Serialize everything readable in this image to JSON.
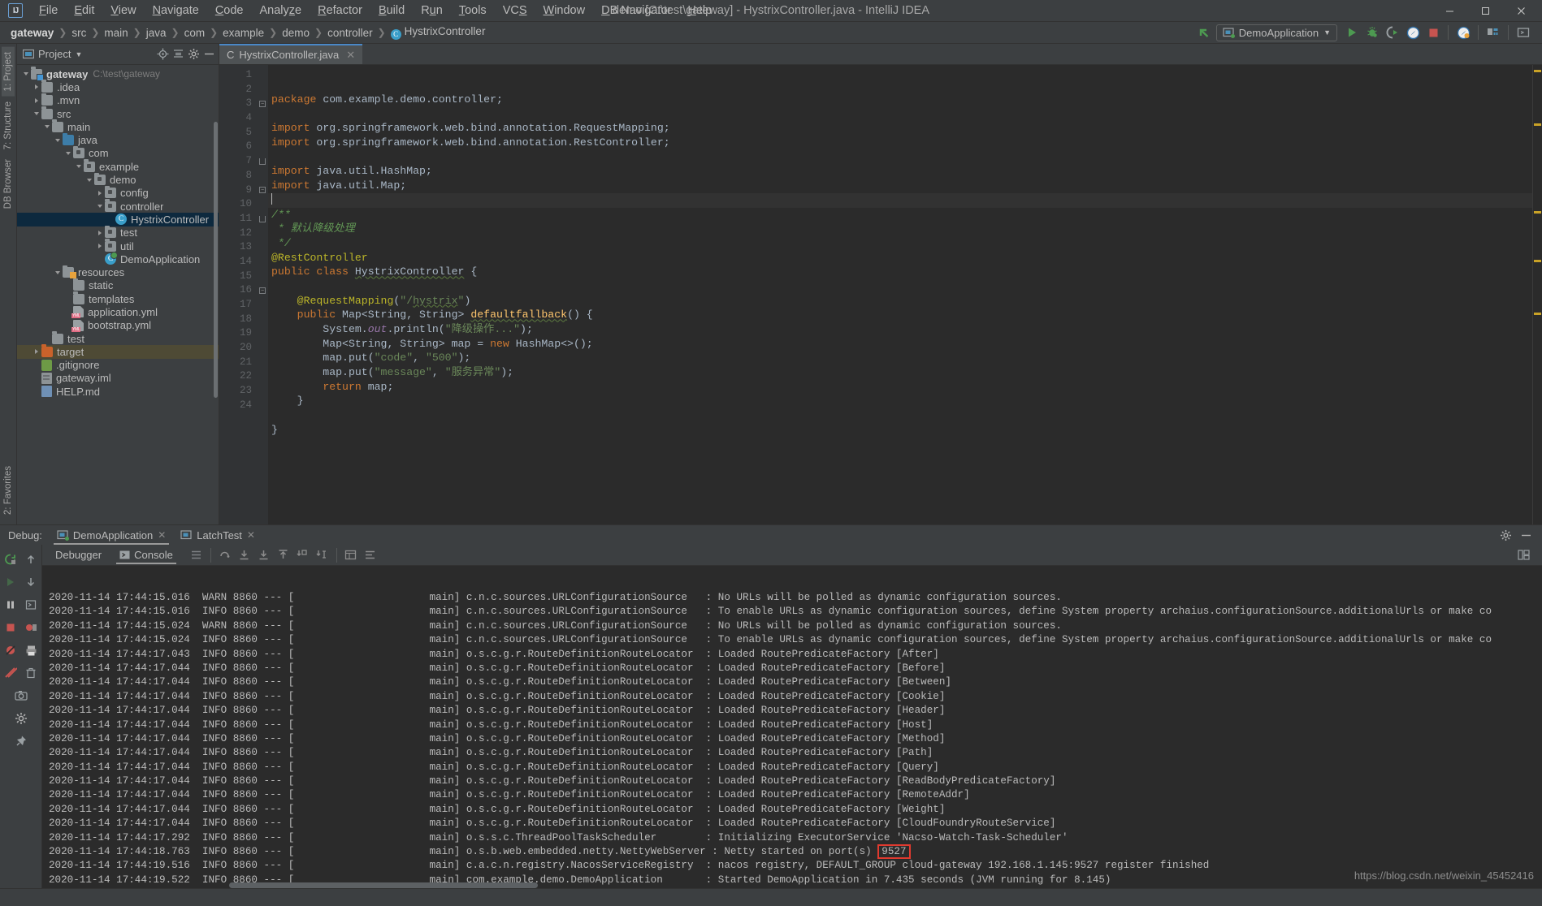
{
  "window": {
    "title": "demo [C:\\test\\gateway] - HystrixController.java - IntelliJ IDEA",
    "logo": "intellij-idea-logo",
    "minimize": "—",
    "maximize": "▢",
    "close": "✕"
  },
  "menu": [
    {
      "label": "File",
      "mnemonic": "F"
    },
    {
      "label": "Edit",
      "mnemonic": "E"
    },
    {
      "label": "View",
      "mnemonic": "V"
    },
    {
      "label": "Navigate",
      "mnemonic": "N"
    },
    {
      "label": "Code",
      "mnemonic": "C"
    },
    {
      "label": "Analyze",
      "mnemonic": "z"
    },
    {
      "label": "Refactor",
      "mnemonic": "R"
    },
    {
      "label": "Build",
      "mnemonic": "B"
    },
    {
      "label": "Run",
      "mnemonic": "u"
    },
    {
      "label": "Tools",
      "mnemonic": "T"
    },
    {
      "label": "VCS",
      "mnemonic": "S"
    },
    {
      "label": "Window",
      "mnemonic": "W"
    },
    {
      "label": "DB Navigator",
      "mnemonic": "D"
    },
    {
      "label": "Help",
      "mnemonic": "H"
    }
  ],
  "breadcrumbs": [
    {
      "label": "gateway",
      "bold": true
    },
    {
      "label": "src",
      "bold": false
    },
    {
      "label": "main",
      "bold": false
    },
    {
      "label": "java",
      "bold": false
    },
    {
      "label": "com",
      "bold": false
    },
    {
      "label": "example",
      "bold": false
    },
    {
      "label": "demo",
      "bold": false
    },
    {
      "label": "controller",
      "bold": false
    },
    {
      "label": "HystrixController",
      "bold": false,
      "icon": "class-icon"
    }
  ],
  "toolbar": {
    "nav_up_icon": "navigate-up-icon",
    "run_config_name": "DemoApplication",
    "run_config_icon": "application-config-icon",
    "dropdown_icon": "chevron-down-icon",
    "buttons": [
      {
        "name": "run-button",
        "icon": "play-icon",
        "color": "#4d9a51"
      },
      {
        "name": "debug-button",
        "icon": "bug-icon",
        "color": "#4d9a51"
      },
      {
        "name": "run-with-coverage-button",
        "icon": "coverage-icon",
        "color": "#9a9a9a"
      },
      {
        "name": "profile-button",
        "icon": "profiler-icon",
        "color": "#4a88c7"
      },
      {
        "name": "stop-button",
        "icon": "stop-square-icon",
        "color": "#c75450"
      },
      {
        "name": "update-app-button",
        "icon": "update-icon",
        "color": "#4a88c7"
      },
      {
        "name": "project-structure-button",
        "icon": "project-structure-icon",
        "color": "#9a9a9a"
      },
      {
        "name": "terminal-button",
        "icon": "terminal-icon",
        "color": "#9a9a9a"
      }
    ]
  },
  "left_strip": {
    "tabs": [
      {
        "label": "1: Project",
        "icon": "project-icon",
        "active": true
      },
      {
        "label": "7: Structure",
        "icon": "structure-icon",
        "active": false
      },
      {
        "label": "DB Browser",
        "icon": "database-icon",
        "active": false
      }
    ],
    "bottom": [
      {
        "label": "2: Favorites",
        "icon": "favorites-icon"
      }
    ]
  },
  "project_panel": {
    "title": "Project",
    "dropdown_icon": "chevron-down-icon",
    "header_icons": [
      "locate-icon",
      "collapse-all-icon",
      "settings-gear-icon",
      "hide-icon"
    ],
    "tree": [
      {
        "depth": 0,
        "label": "gateway",
        "suffix": "C:\\test\\gateway",
        "icon": "module-folder",
        "expander": "open",
        "bold": true,
        "state": "normal"
      },
      {
        "depth": 1,
        "label": ".idea",
        "icon": "folder-gray",
        "expander": "closed",
        "state": "normal"
      },
      {
        "depth": 1,
        "label": ".mvn",
        "icon": "folder-gray",
        "expander": "closed",
        "state": "normal"
      },
      {
        "depth": 1,
        "label": "src",
        "icon": "folder-gray",
        "expander": "open",
        "state": "normal"
      },
      {
        "depth": 2,
        "label": "main",
        "icon": "folder-gray",
        "expander": "open",
        "state": "normal"
      },
      {
        "depth": 3,
        "label": "java",
        "icon": "folder-blue",
        "expander": "open",
        "state": "normal"
      },
      {
        "depth": 4,
        "label": "com",
        "icon": "package",
        "expander": "open",
        "state": "normal"
      },
      {
        "depth": 5,
        "label": "example",
        "icon": "package",
        "expander": "open",
        "state": "normal"
      },
      {
        "depth": 6,
        "label": "demo",
        "icon": "package",
        "expander": "open",
        "state": "normal"
      },
      {
        "depth": 7,
        "label": "config",
        "icon": "package",
        "expander": "closed",
        "state": "normal"
      },
      {
        "depth": 7,
        "label": "controller",
        "icon": "package",
        "expander": "open",
        "state": "normal"
      },
      {
        "depth": 8,
        "label": "HystrixController",
        "icon": "class",
        "expander": "none",
        "state": "selected"
      },
      {
        "depth": 7,
        "label": "test",
        "icon": "package",
        "expander": "closed",
        "state": "normal"
      },
      {
        "depth": 7,
        "label": "util",
        "icon": "package",
        "expander": "closed",
        "state": "normal"
      },
      {
        "depth": 7,
        "label": "DemoApplication",
        "icon": "class-run",
        "expander": "none",
        "state": "normal"
      },
      {
        "depth": 3,
        "label": "resources",
        "icon": "folder-resources",
        "expander": "open",
        "state": "normal"
      },
      {
        "depth": 4,
        "label": "static",
        "icon": "folder-gray",
        "expander": "none",
        "state": "normal"
      },
      {
        "depth": 4,
        "label": "templates",
        "icon": "folder-gray",
        "expander": "none",
        "state": "normal"
      },
      {
        "depth": 4,
        "label": "application.yml",
        "icon": "yml",
        "expander": "none",
        "state": "normal"
      },
      {
        "depth": 4,
        "label": "bootstrap.yml",
        "icon": "yml",
        "expander": "none",
        "state": "normal"
      },
      {
        "depth": 2,
        "label": "test",
        "icon": "folder-gray",
        "expander": "none",
        "state": "normal"
      },
      {
        "depth": 1,
        "label": "target",
        "icon": "folder-orange",
        "expander": "closed",
        "state": "selected-inactive"
      },
      {
        "depth": 1,
        "label": ".gitignore",
        "icon": "gitignore",
        "expander": "none",
        "state": "normal"
      },
      {
        "depth": 1,
        "label": "gateway.iml",
        "icon": "iml",
        "expander": "none",
        "state": "normal"
      },
      {
        "depth": 1,
        "label": "HELP.md",
        "icon": "markdown",
        "expander": "none",
        "state": "normal"
      }
    ]
  },
  "editor": {
    "tab": {
      "label": "HystrixController.java",
      "icon": "class-icon",
      "close": "✕"
    },
    "line_numbers": [
      1,
      2,
      3,
      4,
      5,
      6,
      7,
      8,
      9,
      10,
      11,
      12,
      13,
      14,
      15,
      16,
      17,
      18,
      19,
      20,
      21,
      22,
      23,
      24
    ],
    "current_line": 8,
    "lines": [
      {
        "n": 1,
        "html": "<span class='kw'>package</span> com.example.demo.controller;"
      },
      {
        "n": 2,
        "html": ""
      },
      {
        "n": 3,
        "html": "<span class='kw'>import</span> org.springframework.web.bind.annotation.<span class='cls-name'>RequestMapping</span>;"
      },
      {
        "n": 4,
        "html": "<span class='kw'>import</span> org.springframework.web.bind.annotation.<span class='cls-name'>RestController</span>;"
      },
      {
        "n": 5,
        "html": ""
      },
      {
        "n": 6,
        "html": "<span class='kw'>import</span> java.util.HashMap;"
      },
      {
        "n": 7,
        "html": "<span class='kw'>import</span> java.util.Map;"
      },
      {
        "n": 8,
        "html": "<span class='caret'></span>"
      },
      {
        "n": 9,
        "html": "<span class='cmt'>/**</span>"
      },
      {
        "n": 10,
        "html": "<span class='cmt'> * 默认降级处理</span>"
      },
      {
        "n": 11,
        "html": "<span class='cmt'> */</span>"
      },
      {
        "n": 12,
        "html": "<span class='ann'>@RestController</span>"
      },
      {
        "n": 13,
        "html": "<span class='kw'>public class</span> <span class='warnu'>HystrixController</span> {"
      },
      {
        "n": 14,
        "html": ""
      },
      {
        "n": 15,
        "html": "    <span class='ann'>@RequestMapping</span>(<span class='str'>\"/<span class='warnu'>hystrix</span>\"</span>)"
      },
      {
        "n": 16,
        "html": "    <span class='kw'>public</span> Map&lt;String, String&gt; <span class='warnu' style='color:#ffc66d'>defaultfallback</span>() {"
      },
      {
        "n": 17,
        "html": "        System.<span class='field-it'>out</span>.println(<span class='str'>\"降级操作...\"</span>);"
      },
      {
        "n": 18,
        "html": "        Map&lt;String, String&gt; map = <span class='kw'>new</span> HashMap&lt;&gt;();"
      },
      {
        "n": 19,
        "html": "        map.put(<span class='str'>\"code\"</span>, <span class='str'>\"500\"</span>);"
      },
      {
        "n": 20,
        "html": "        map.put(<span class='str'>\"message\"</span>, <span class='str'>\"服务异常\"</span>);"
      },
      {
        "n": 21,
        "html": "        <span class='kw'>return</span> map;"
      },
      {
        "n": 22,
        "html": "    }"
      },
      {
        "n": 23,
        "html": ""
      },
      {
        "n": 24,
        "html": "}"
      }
    ]
  },
  "debug": {
    "label": "Debug:",
    "tabs": [
      {
        "label": "DemoApplication",
        "icon": "app-config-icon",
        "active": true,
        "close": "✕"
      },
      {
        "label": "LatchTest",
        "icon": "app-config-icon",
        "active": false,
        "close": "✕"
      }
    ],
    "header_right_icons": [
      "settings-gear-icon",
      "hide-panel-icon"
    ],
    "subtabs": [
      {
        "label": "Debugger",
        "active": false
      },
      {
        "label": "Console",
        "active": true,
        "icon": "console-icon"
      }
    ],
    "toolbar_icons": [
      "soft-wrap-icon",
      "step-over-icon",
      "step-into-icon",
      "force-step-into-icon",
      "step-out-icon",
      "drop-frame-icon",
      "run-to-cursor-icon",
      "evaluate-expression-icon",
      "layout-icon"
    ],
    "left_icons": [
      "rerun-icon",
      "resume-icon",
      "step-up-icon",
      "pause-icon",
      "stop-icon",
      "view-breakpoints-icon",
      "mute-breakpoints-icon",
      "print-icon",
      "settings-icon",
      "camera-icon",
      "trash-icon",
      "gear-icon",
      "pin-icon"
    ],
    "right_icons": [
      "toggle-tabs-icon",
      "restore-layout-icon"
    ]
  },
  "console": {
    "port_highlight": "9527",
    "watermark": "https://blog.csdn.net/weixin_45452416",
    "lines": [
      {
        "ts": "2020-11-14 17:44:15.016",
        "level": "WARN",
        "pid": "8860",
        "thread": "main",
        "logger": "c.n.c.sources.URLConfigurationSource",
        "msg": "No URLs will be polled as dynamic configuration sources."
      },
      {
        "ts": "2020-11-14 17:44:15.016",
        "level": "INFO",
        "pid": "8860",
        "thread": "main",
        "logger": "c.n.c.sources.URLConfigurationSource",
        "msg": "To enable URLs as dynamic configuration sources, define System property archaius.configurationSource.additionalUrls or make co"
      },
      {
        "ts": "2020-11-14 17:44:15.024",
        "level": "WARN",
        "pid": "8860",
        "thread": "main",
        "logger": "c.n.c.sources.URLConfigurationSource",
        "msg": "No URLs will be polled as dynamic configuration sources."
      },
      {
        "ts": "2020-11-14 17:44:15.024",
        "level": "INFO",
        "pid": "8860",
        "thread": "main",
        "logger": "c.n.c.sources.URLConfigurationSource",
        "msg": "To enable URLs as dynamic configuration sources, define System property archaius.configurationSource.additionalUrls or make co"
      },
      {
        "ts": "2020-11-14 17:44:17.043",
        "level": "INFO",
        "pid": "8860",
        "thread": "main",
        "logger": "o.s.c.g.r.RouteDefinitionRouteLocator",
        "msg": "Loaded RoutePredicateFactory [After]"
      },
      {
        "ts": "2020-11-14 17:44:17.044",
        "level": "INFO",
        "pid": "8860",
        "thread": "main",
        "logger": "o.s.c.g.r.RouteDefinitionRouteLocator",
        "msg": "Loaded RoutePredicateFactory [Before]"
      },
      {
        "ts": "2020-11-14 17:44:17.044",
        "level": "INFO",
        "pid": "8860",
        "thread": "main",
        "logger": "o.s.c.g.r.RouteDefinitionRouteLocator",
        "msg": "Loaded RoutePredicateFactory [Between]"
      },
      {
        "ts": "2020-11-14 17:44:17.044",
        "level": "INFO",
        "pid": "8860",
        "thread": "main",
        "logger": "o.s.c.g.r.RouteDefinitionRouteLocator",
        "msg": "Loaded RoutePredicateFactory [Cookie]"
      },
      {
        "ts": "2020-11-14 17:44:17.044",
        "level": "INFO",
        "pid": "8860",
        "thread": "main",
        "logger": "o.s.c.g.r.RouteDefinitionRouteLocator",
        "msg": "Loaded RoutePredicateFactory [Header]"
      },
      {
        "ts": "2020-11-14 17:44:17.044",
        "level": "INFO",
        "pid": "8860",
        "thread": "main",
        "logger": "o.s.c.g.r.RouteDefinitionRouteLocator",
        "msg": "Loaded RoutePredicateFactory [Host]"
      },
      {
        "ts": "2020-11-14 17:44:17.044",
        "level": "INFO",
        "pid": "8860",
        "thread": "main",
        "logger": "o.s.c.g.r.RouteDefinitionRouteLocator",
        "msg": "Loaded RoutePredicateFactory [Method]"
      },
      {
        "ts": "2020-11-14 17:44:17.044",
        "level": "INFO",
        "pid": "8860",
        "thread": "main",
        "logger": "o.s.c.g.r.RouteDefinitionRouteLocator",
        "msg": "Loaded RoutePredicateFactory [Path]"
      },
      {
        "ts": "2020-11-14 17:44:17.044",
        "level": "INFO",
        "pid": "8860",
        "thread": "main",
        "logger": "o.s.c.g.r.RouteDefinitionRouteLocator",
        "msg": "Loaded RoutePredicateFactory [Query]"
      },
      {
        "ts": "2020-11-14 17:44:17.044",
        "level": "INFO",
        "pid": "8860",
        "thread": "main",
        "logger": "o.s.c.g.r.RouteDefinitionRouteLocator",
        "msg": "Loaded RoutePredicateFactory [ReadBodyPredicateFactory]"
      },
      {
        "ts": "2020-11-14 17:44:17.044",
        "level": "INFO",
        "pid": "8860",
        "thread": "main",
        "logger": "o.s.c.g.r.RouteDefinitionRouteLocator",
        "msg": "Loaded RoutePredicateFactory [RemoteAddr]"
      },
      {
        "ts": "2020-11-14 17:44:17.044",
        "level": "INFO",
        "pid": "8860",
        "thread": "main",
        "logger": "o.s.c.g.r.RouteDefinitionRouteLocator",
        "msg": "Loaded RoutePredicateFactory [Weight]"
      },
      {
        "ts": "2020-11-14 17:44:17.044",
        "level": "INFO",
        "pid": "8860",
        "thread": "main",
        "logger": "o.s.c.g.r.RouteDefinitionRouteLocator",
        "msg": "Loaded RoutePredicateFactory [CloudFoundryRouteService]"
      },
      {
        "ts": "2020-11-14 17:44:17.292",
        "level": "INFO",
        "pid": "8860",
        "thread": "main",
        "logger": "o.s.s.c.ThreadPoolTaskScheduler",
        "msg": "Initializing ExecutorService 'Nacso-Watch-Task-Scheduler'"
      },
      {
        "ts": "2020-11-14 17:44:18.763",
        "level": "INFO",
        "pid": "8860",
        "thread": "main",
        "logger": "o.s.b.web.embedded.netty.NettyWebServer",
        "msg": "Netty started on port(s)",
        "highlight": "9527"
      },
      {
        "ts": "2020-11-14 17:44:19.516",
        "level": "INFO",
        "pid": "8860",
        "thread": "main",
        "logger": "c.a.c.n.registry.NacosServiceRegistry",
        "msg": "nacos registry, DEFAULT_GROUP cloud-gateway 192.168.1.145:9527 register finished"
      },
      {
        "ts": "2020-11-14 17:44:19.522",
        "level": "INFO",
        "pid": "8860",
        "thread": "main",
        "logger": "com.example.demo.DemoApplication",
        "msg": "Started DemoApplication in 7.435 seconds (JVM running for 8.145)"
      }
    ]
  },
  "colors": {
    "bg_chrome": "#3c3f41",
    "bg_editor": "#2b2b2b",
    "accent_blue": "#4a88c7",
    "selection": "#0d293e",
    "highlight_red": "#e03a2f",
    "keyword_orange": "#cc7832",
    "string_green": "#6a8759",
    "annotation_yellow": "#bbb529",
    "comment_green": "#629755"
  }
}
